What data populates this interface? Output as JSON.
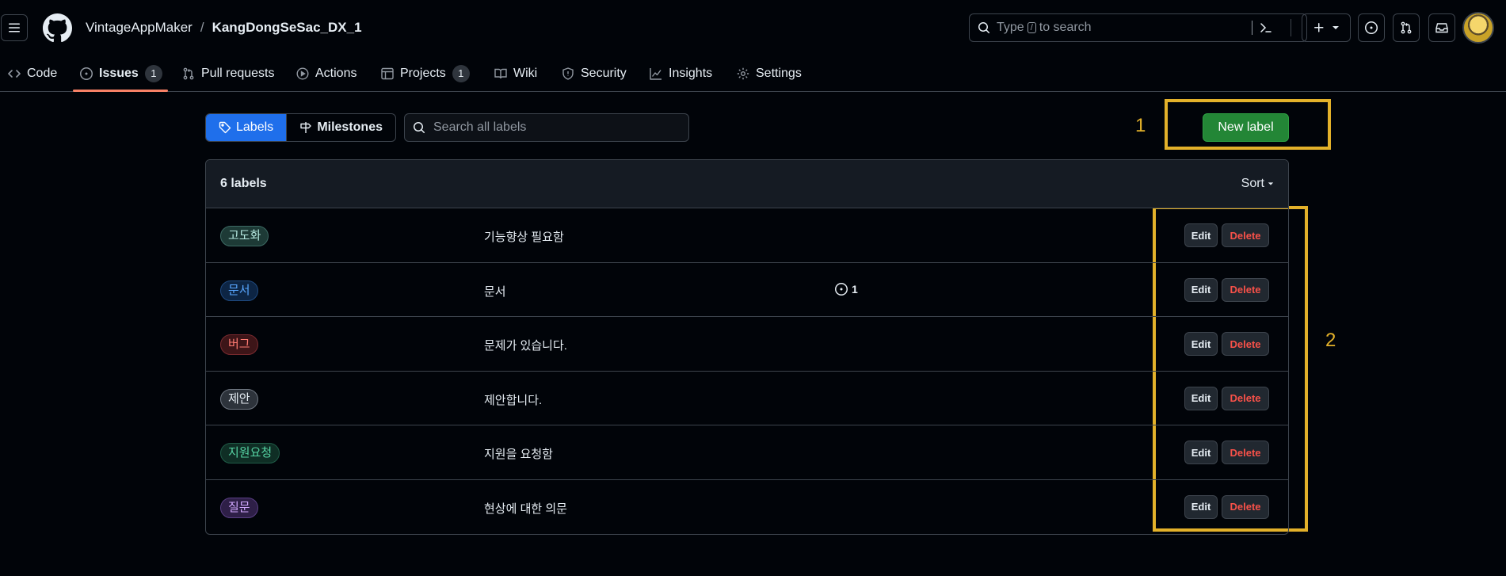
{
  "header": {
    "owner": "VintageAppMaker",
    "separator": "/",
    "repo": "KangDongSeSac_DX_1",
    "search_prefix": "Type",
    "search_key": "/",
    "search_suffix": "to search"
  },
  "repo_nav": {
    "items": [
      {
        "label": "Code",
        "icon": "code-icon"
      },
      {
        "label": "Issues",
        "icon": "issue-opened-icon",
        "count": "1",
        "active": true
      },
      {
        "label": "Pull requests",
        "icon": "git-pull-request-icon"
      },
      {
        "label": "Actions",
        "icon": "play-icon"
      },
      {
        "label": "Projects",
        "icon": "table-icon",
        "count": "1"
      },
      {
        "label": "Wiki",
        "icon": "book-icon"
      },
      {
        "label": "Security",
        "icon": "shield-icon"
      },
      {
        "label": "Insights",
        "icon": "graph-icon"
      },
      {
        "label": "Settings",
        "icon": "gear-icon"
      }
    ]
  },
  "subnav": {
    "labels_tab": "Labels",
    "milestones_tab": "Milestones",
    "search_placeholder": "Search all labels",
    "new_label_button": "New label"
  },
  "annotations": {
    "marker_1": "1",
    "marker_2": "2",
    "color": "#e3b12a"
  },
  "labels_box": {
    "count_text": "6 labels",
    "sort_label": "Sort",
    "rows": [
      {
        "name": "고도화",
        "description": "기능향상 필요함",
        "open_issues": "",
        "text_color": "#b5e8e0",
        "bg": "#1d3a36",
        "border": "#3d6b64",
        "edit": "Edit",
        "delete": "Delete"
      },
      {
        "name": "문서",
        "description": "문서",
        "open_issues": "1",
        "text_color": "#58a6ff",
        "bg": "#0d2544",
        "border": "#1f4a80",
        "edit": "Edit",
        "delete": "Delete"
      },
      {
        "name": "버그",
        "description": "문제가 있습니다.",
        "open_issues": "",
        "text_color": "#ff7b72",
        "bg": "#3d1518",
        "border": "#7a2a2f",
        "edit": "Edit",
        "delete": "Delete"
      },
      {
        "name": "제안",
        "description": "제안합니다.",
        "open_issues": "",
        "text_color": "#e6edf3",
        "bg": "#2d333b",
        "border": "#6e7681",
        "edit": "Edit",
        "delete": "Delete"
      },
      {
        "name": "지원요청",
        "description": "지원을 요청함",
        "open_issues": "",
        "text_color": "#56d4a4",
        "bg": "#0f2e25",
        "border": "#1f5c47",
        "edit": "Edit",
        "delete": "Delete"
      },
      {
        "name": "질문",
        "description": "현상에 대한 의문",
        "open_issues": "",
        "text_color": "#d2a8ff",
        "bg": "#2e1f47",
        "border": "#5a3f85",
        "edit": "Edit",
        "delete": "Delete"
      }
    ]
  }
}
